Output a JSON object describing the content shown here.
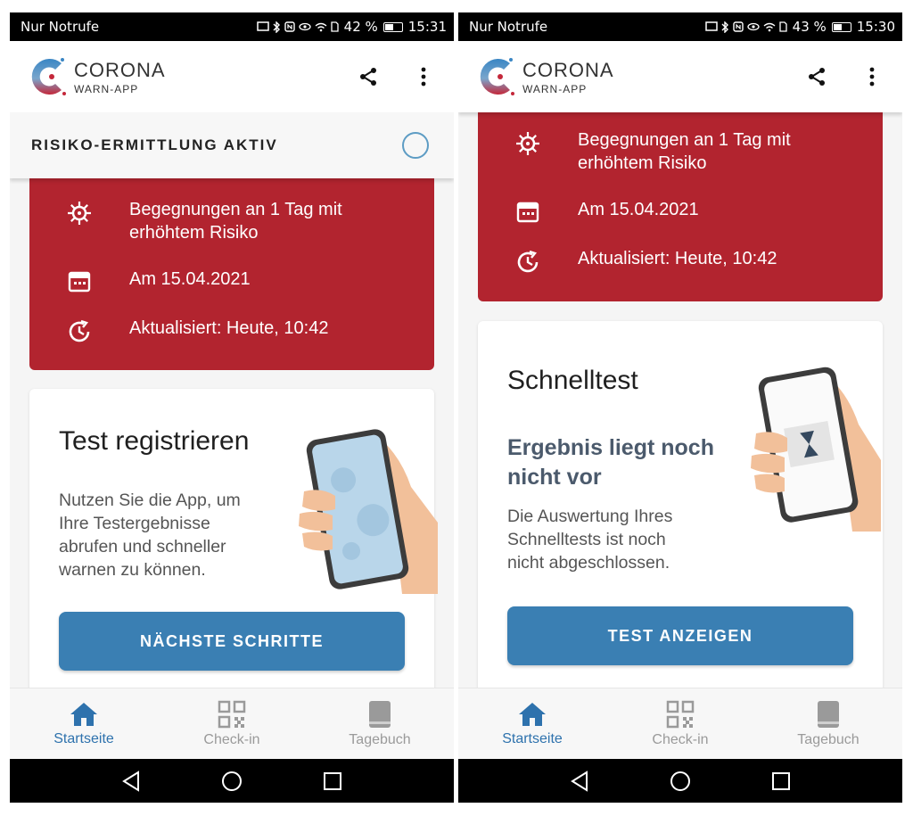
{
  "colors": {
    "accent": "#3a7fb3",
    "risk_red": "#b2242f",
    "nav_active": "#2e72ad",
    "nav_inactive": "#9a9a9a",
    "subtitle": "#4b5a6c"
  },
  "left": {
    "status": {
      "carrier": "Nur Notrufe",
      "battery": "42 %",
      "time": "15:31"
    },
    "logo": {
      "title": "CORONA",
      "subtitle": "WARN-APP"
    },
    "risk_header": {
      "title": "RISIKO-ERMITTLUNG AKTIV"
    },
    "risk_card": {
      "rows": [
        {
          "icon": "virus-icon",
          "text_l1": "Begegnungen an 1 Tag mit",
          "text_l2": "erhöhtem Risiko"
        },
        {
          "icon": "calendar-icon",
          "text": "Am 15.04.2021"
        },
        {
          "icon": "clock-refresh-icon",
          "text": "Aktualisiert: Heute, 10:42"
        }
      ]
    },
    "test_card": {
      "title": "Test registrieren",
      "body": [
        "Nutzen Sie die App, um",
        "Ihre Testergebnisse",
        "abrufen und schneller",
        "warnen zu können."
      ],
      "button": "NÄCHSTE SCHRITTE"
    },
    "nav": {
      "home": "Startseite",
      "checkin": "Check-in",
      "diary": "Tagebuch"
    }
  },
  "right": {
    "status": {
      "carrier": "Nur Notrufe",
      "battery": "43 %",
      "time": "15:30"
    },
    "logo": {
      "title": "CORONA",
      "subtitle": "WARN-APP"
    },
    "risk_card": {
      "rows": [
        {
          "icon": "virus-icon",
          "text_l1": "Begegnungen an 1 Tag mit",
          "text_l2": "erhöhtem Risiko"
        },
        {
          "icon": "calendar-icon",
          "text": "Am 15.04.2021"
        },
        {
          "icon": "clock-refresh-icon",
          "text": "Aktualisiert: Heute, 10:42"
        }
      ]
    },
    "test_card": {
      "title": "Schnelltest",
      "subtitle": [
        "Ergebnis liegt noch",
        "nicht vor"
      ],
      "body": [
        "Die Auswertung Ihres",
        "Schnelltests ist noch",
        "nicht abgeschlossen."
      ],
      "button": "TEST ANZEIGEN"
    },
    "nav": {
      "home": "Startseite",
      "checkin": "Check-in",
      "diary": "Tagebuch"
    }
  }
}
